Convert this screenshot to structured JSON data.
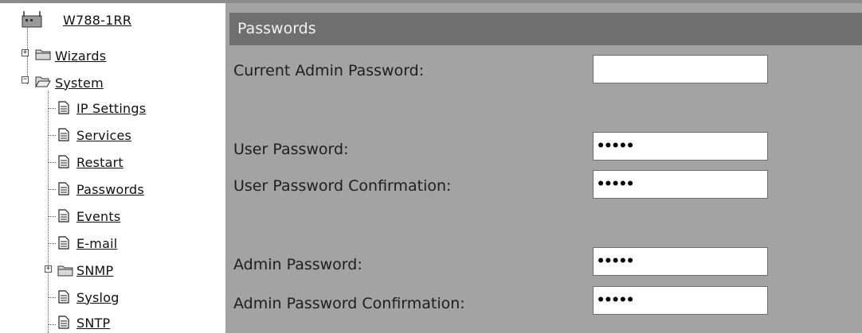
{
  "sidebar": {
    "device": {
      "label": "W788-1RR",
      "icon": "device-icon"
    },
    "items": [
      {
        "label": "Wizards",
        "icon": "folder-icon",
        "expander": "+"
      },
      {
        "label": "System",
        "icon": "folder-open-icon",
        "expander": "-"
      },
      {
        "label": "IP Settings",
        "icon": "page-icon"
      },
      {
        "label": "Services",
        "icon": "page-icon"
      },
      {
        "label": "Restart",
        "icon": "page-icon"
      },
      {
        "label": "Passwords",
        "icon": "page-icon"
      },
      {
        "label": "Events",
        "icon": "page-icon"
      },
      {
        "label": "E-mail",
        "icon": "page-icon"
      },
      {
        "label": "SNMP",
        "icon": "folder-icon",
        "expander": "+"
      },
      {
        "label": "Syslog",
        "icon": "page-icon"
      },
      {
        "label": "SNTP",
        "icon": "page-icon"
      }
    ]
  },
  "panel": {
    "title": "Passwords",
    "fields": [
      {
        "label": "Current Admin Password:",
        "value": ""
      },
      {
        "label": "User Password:",
        "value": "•••••"
      },
      {
        "label": "User Password Confirmation:",
        "value": "•••••"
      },
      {
        "label": "Admin Password:",
        "value": "•••••"
      },
      {
        "label": "Admin Password Confirmation:",
        "value": "•••••"
      }
    ]
  },
  "colors": {
    "panel_bg": "#a3a3a3",
    "header_bg": "#6f6f6f",
    "header_text": "#f2f2f2",
    "input_bg": "#ffffff"
  }
}
